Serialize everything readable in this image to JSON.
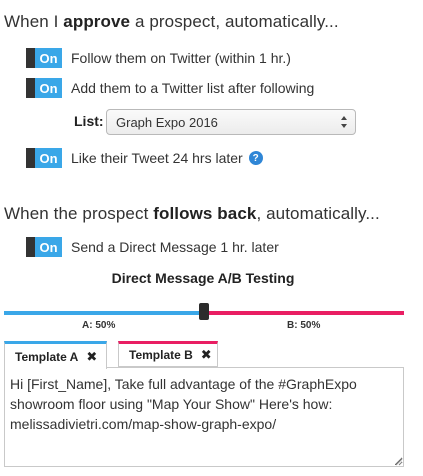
{
  "section1": {
    "heading_prefix": "When I ",
    "heading_bold": "approve",
    "heading_suffix": " a prospect, automatically..."
  },
  "toggles": {
    "follow": {
      "state": "On",
      "label": "Follow them on Twitter (within 1 hr.)"
    },
    "add_list": {
      "state": "On",
      "label": "Add them to a Twitter list after following"
    },
    "like": {
      "state": "On",
      "label": "Like their Tweet 24 hrs later"
    },
    "dm": {
      "state": "On",
      "label": "Send a Direct Message 1 hr. later"
    }
  },
  "list": {
    "label": "List:",
    "selected": "Graph Expo 2016"
  },
  "help": {
    "glyph": "?"
  },
  "section2": {
    "heading_prefix": "When the prospect ",
    "heading_bold": "follows back",
    "heading_suffix": ", automatically..."
  },
  "ab_testing": {
    "title": "Direct Message A/B Testing",
    "a_label": "A: 50%",
    "b_label": "B: 50%",
    "split_a_fraction": 0.5,
    "color_a": "#3aa7e8",
    "color_b": "#e91e63"
  },
  "tabs": {
    "a_label": "Template A",
    "b_label": "Template B",
    "close_glyph": "✖"
  },
  "message": {
    "text": "Hi [First_Name], Take full advantage of the #GraphExpo showroom floor using \"Map Your Show\" Here's how: melissadivietri.com/map-show-graph-expo/"
  },
  "icons": {
    "help": "help-circle-icon",
    "close": "close-icon",
    "select_arrows": "chevron-updown-icon",
    "resize": "resize-grip-icon"
  }
}
